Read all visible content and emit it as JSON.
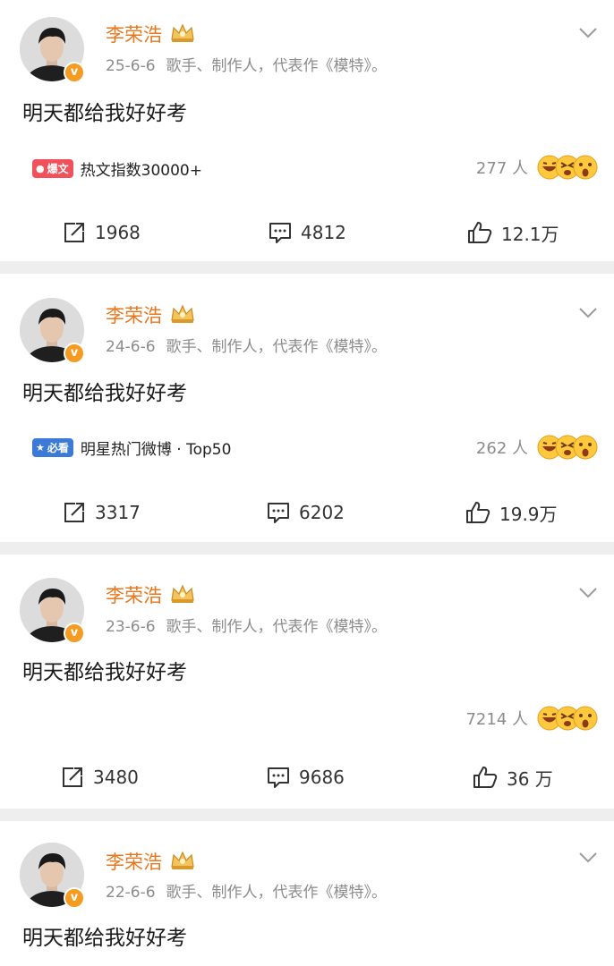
{
  "posts": [
    {
      "username": "李荣浩",
      "date": "25-6-6",
      "description": "歌手、制作人，代表作《模特》。",
      "content": "明天都给我好好考",
      "hot_badge": "爆文",
      "hot_badge_color": "#f0515a",
      "hot_text": "热文指数30000+",
      "reaction_count": "277 人",
      "repost": "1968",
      "comment": "4812",
      "like": "12.1万"
    },
    {
      "username": "李荣浩",
      "date": "24-6-6",
      "description": "歌手、制作人，代表作《模特》。",
      "content": "明天都给我好好考",
      "hot_badge": "必看",
      "hot_badge_color": "#3c7ad8",
      "hot_text": "明星热门微博 · Top50",
      "reaction_count": "262 人",
      "repost": "3317",
      "comment": "6202",
      "like": "19.9万"
    },
    {
      "username": "李荣浩",
      "date": "23-6-6",
      "description": "歌手、制作人，代表作《模特》。",
      "content": "明天都给我好好考",
      "reaction_count": "7214 人",
      "repost": "3480",
      "comment": "9686",
      "like": "36 万"
    },
    {
      "username": "李荣浩",
      "date": "22-6-6",
      "description": "歌手、制作人，代表作《模特》。",
      "content": "明天都给我好好考"
    }
  ],
  "icons": {
    "verified": "v",
    "repost": "repost-icon",
    "comment": "comment-icon",
    "like": "like-icon",
    "menu": "chevron-down-icon"
  },
  "colors": {
    "username": "#e8761b",
    "verified_badge": "#f59b22",
    "separator": "#eeeeee"
  }
}
